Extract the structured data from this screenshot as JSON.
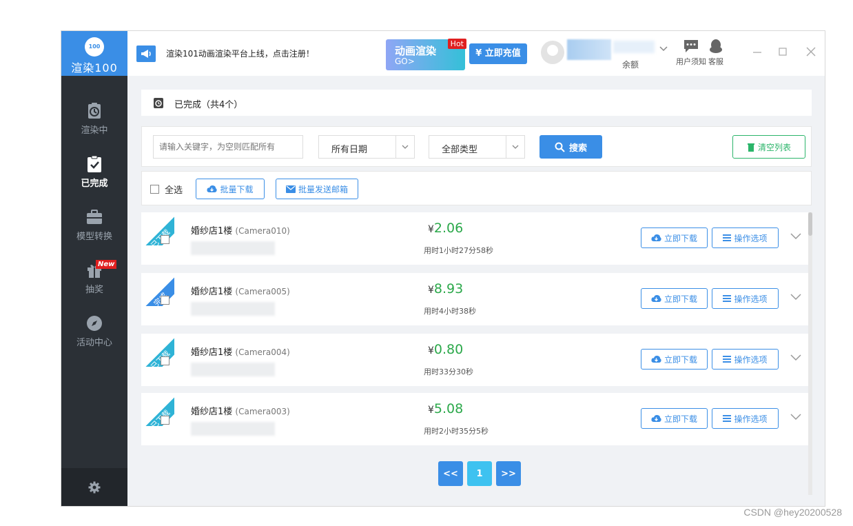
{
  "app": {
    "logo_badge": "100",
    "logo_text": "渲染100"
  },
  "sidebar": {
    "items": [
      {
        "label": "渲染中",
        "icon": "timer-icon",
        "active": false
      },
      {
        "label": "已完成",
        "icon": "clipboard-check-icon",
        "active": true
      },
      {
        "label": "模型转换",
        "icon": "briefcase-icon",
        "active": false
      },
      {
        "label": "抽奖",
        "icon": "gift-icon",
        "active": false,
        "badge": "New"
      },
      {
        "label": "活动中心",
        "icon": "compass-icon",
        "active": false
      }
    ],
    "settings_icon": "gear-icon"
  },
  "topbar": {
    "announcement": "渲染101动画渲染平台上线，点击注册！",
    "promo_title": "动画渲染",
    "promo_sub": "GO>",
    "promo_badge": "Hot",
    "recharge_label": "¥ 立即充值",
    "balance_label": "余额",
    "notice_label": "用户须知",
    "support_label": "客服"
  },
  "status": {
    "title": "已完成（共4个）"
  },
  "filters": {
    "search_placeholder": "请输入关键字，为空则匹配所有",
    "date_select": "所有日期",
    "type_select": "全部类型",
    "search_label": "搜索",
    "clear_label": "清空列表"
  },
  "batch": {
    "select_all": "全选",
    "batch_download": "批量下载",
    "batch_email": "批量发送邮箱"
  },
  "tasks": [
    {
      "ribbon": "已下载",
      "ribbon_color": "#2fb3d6",
      "name": "婚纱店1楼",
      "camera": "(Camera010)",
      "currency": "¥",
      "price": "2.06",
      "duration": "用时1小时27分58秒"
    },
    {
      "ribbon": "完成",
      "ribbon_color": "#3a8ee6",
      "name": "婚纱店1楼",
      "camera": "(Camera005)",
      "currency": "¥",
      "price": "8.93",
      "duration": "用时4小时38秒"
    },
    {
      "ribbon": "已下载",
      "ribbon_color": "#2fb3d6",
      "name": "婚纱店1楼",
      "camera": "(Camera004)",
      "currency": "¥",
      "price": "0.80",
      "duration": "用时33分30秒"
    },
    {
      "ribbon": "已下载",
      "ribbon_color": "#2fb3d6",
      "name": "婚纱店1楼",
      "camera": "(Camera003)",
      "currency": "¥",
      "price": "5.08",
      "duration": "用时2小时35分5秒"
    }
  ],
  "row_actions": {
    "download": "立即下载",
    "options": "操作选项"
  },
  "pagination": {
    "prev": "<<",
    "current": "1",
    "next": ">>"
  },
  "watermark": "CSDN @hey20200528",
  "colors": {
    "accent": "#3a8ee6",
    "success": "#2ba84a",
    "sidebar": "#2b3036"
  }
}
